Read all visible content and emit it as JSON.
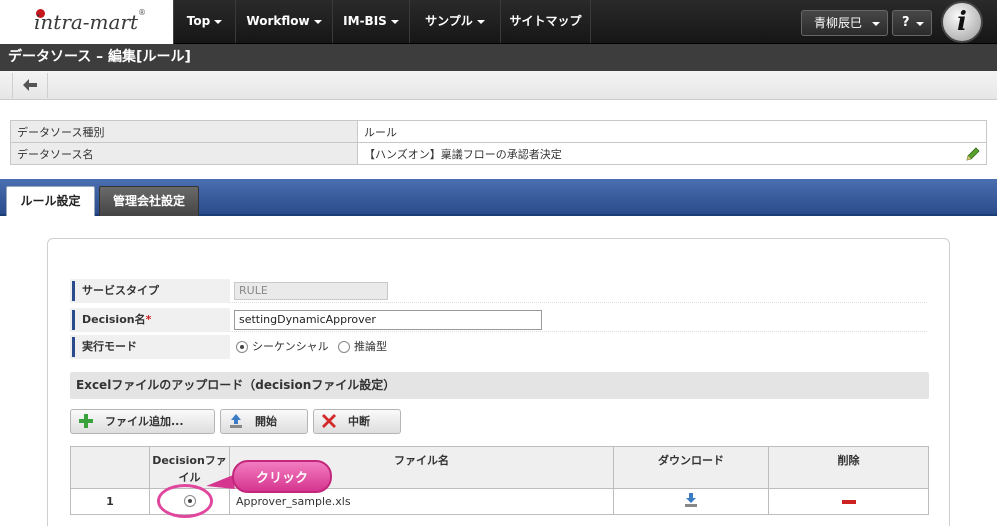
{
  "brand": {
    "logo_text": "intra-mart",
    "reg": "®"
  },
  "nav": {
    "items": [
      {
        "label": "Top"
      },
      {
        "label": "Workflow"
      },
      {
        "label": "IM-BIS"
      },
      {
        "label": "サンプル"
      },
      {
        "label": "サイトマップ"
      }
    ],
    "user": "青柳辰巳",
    "help": "?",
    "mark": "i"
  },
  "page": {
    "title": "データソース – 編集[ルール]"
  },
  "toolbar": {
    "back_icon": "back-arrow-icon"
  },
  "info": {
    "rows": [
      {
        "label": "データソース種別",
        "value": "ルール"
      },
      {
        "label": "データソース名",
        "value": "【ハンズオン】稟議フローの承認者決定"
      }
    ]
  },
  "tabs": [
    {
      "label": "ルール設定",
      "active": true
    },
    {
      "label": "管理会社設定",
      "active": false
    }
  ],
  "form": {
    "service_type": {
      "label": "サービスタイプ",
      "value": "RULE"
    },
    "decision_name": {
      "label": "Decision名",
      "required_mark": "*",
      "value": "settingDynamicApprover"
    },
    "exec_mode": {
      "label": "実行モード",
      "options": [
        "シーケンシャル",
        "推論型"
      ],
      "selected": "シーケンシャル"
    }
  },
  "upload": {
    "heading": "Excelファイルのアップロード（decisionファイル設定）",
    "buttons": {
      "add": "ファイル追加...",
      "start": "開始",
      "stop": "中断"
    },
    "columns": [
      "",
      "Decisionファイル",
      "ファイル名",
      "ダウンロード",
      "削除"
    ],
    "rows": [
      {
        "no": "1",
        "decision_selected": true,
        "filename": "Approver_sample.xls"
      }
    ]
  },
  "callout": {
    "text": "クリック"
  },
  "colors": {
    "accent": "#2b4c8c",
    "callout": "#d6358f",
    "delete": "#cc2222"
  }
}
